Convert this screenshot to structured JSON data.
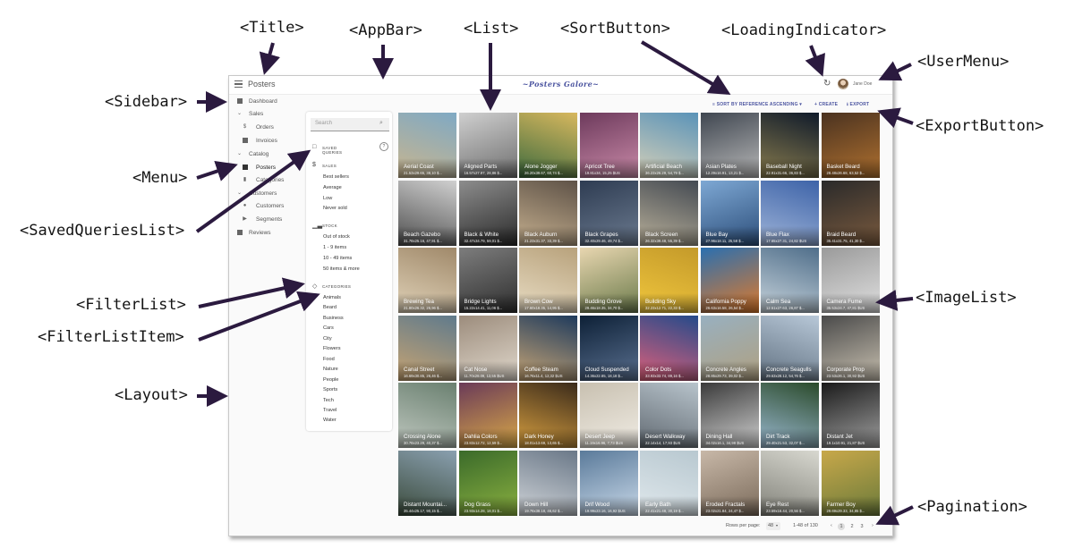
{
  "callouts": {
    "title": "<Title>",
    "appbar": "<AppBar>",
    "list": "<List>",
    "sort_button": "<SortButton>",
    "loading_indicator": "<LoadingIndicator>",
    "user_menu": "<UserMenu>",
    "sidebar": "<Sidebar>",
    "export_button": "<ExportButton>",
    "menu": "<Menu>",
    "saved_queries_list": "<SavedQueriesList>",
    "image_list": "<ImageList>",
    "filter_list": "<FilterList>",
    "filter_list_item": "<FilterListItem>",
    "layout": "<Layout>",
    "pagination": "<Pagination>"
  },
  "appbar": {
    "title": "Posters",
    "brand": "~Posters Galore~",
    "refresh_icon": "refresh-icon",
    "user_name": "Jane Doe"
  },
  "sidebar": {
    "items": [
      {
        "label": "Dashboard",
        "icon": "dashboard-icon"
      },
      {
        "label": "Sales",
        "icon": "chevron-down-icon"
      },
      {
        "label": "Orders",
        "icon": "dollar-icon"
      },
      {
        "label": "Invoices",
        "icon": "invoices-icon"
      },
      {
        "label": "Catalog",
        "icon": "chevron-down-icon"
      },
      {
        "label": "Posters",
        "icon": "posters-icon"
      },
      {
        "label": "Categories",
        "icon": "bookmark-icon"
      },
      {
        "label": "Customers",
        "icon": "chevron-down-icon"
      },
      {
        "label": "Customers",
        "icon": "people-icon"
      },
      {
        "label": "Segments",
        "icon": "label-icon"
      },
      {
        "label": "Reviews",
        "icon": "comment-icon"
      }
    ]
  },
  "filters": {
    "search_placeholder": "Search",
    "saved_queries": "SAVED QUERIES",
    "sales": {
      "title": "SALES",
      "items": [
        "Best sellers",
        "Average",
        "Low",
        "Never sold"
      ]
    },
    "stock": {
      "title": "STOCK",
      "items": [
        "Out of stock",
        "1 - 9 items",
        "10 - 49 items",
        "50 items & more"
      ]
    },
    "categories": {
      "title": "CATEGORIES",
      "items": [
        "Animals",
        "Beard",
        "Business",
        "Cars",
        "City",
        "Flowers",
        "Food",
        "Nature",
        "People",
        "Sports",
        "Tech",
        "Travel",
        "Water"
      ]
    }
  },
  "toolbar": {
    "sort_label": "SORT BY REFERENCE ASCENDING",
    "create_label": "CREATE",
    "export_label": "EXPORT"
  },
  "posters": [
    {
      "title": "Aerial Coast",
      "sub": "21.53x29.65, 38,10 $..."
    },
    {
      "title": "Aligned Parts",
      "sub": "16.57x27.97, 28,86 $..."
    },
    {
      "title": "Alone Jogger",
      "sub": "26.20x39.67, 60,74 $..."
    },
    {
      "title": "Apricot Tree",
      "sub": "19.81x34, 15,25 $US"
    },
    {
      "title": "Artificial Beach",
      "sub": "36.23x26.29, 54,79 $..."
    },
    {
      "title": "Asian Plates",
      "sub": "12.29x16.91, 13,21 $..."
    },
    {
      "title": "Baseball Night",
      "sub": "22.91x31.66, 36,83 $..."
    },
    {
      "title": "Basket Beard",
      "sub": "28.48x26.68, 63,52 $..."
    },
    {
      "title": "Beach Gazebo",
      "sub": "31.78x25.16, 47,91 $..."
    },
    {
      "title": "Black & White",
      "sub": "32.47x34.79, 59,01 $..."
    },
    {
      "title": "Black Auburn",
      "sub": "21.23x31.37, 33,39 $..."
    },
    {
      "title": "Black Grapes",
      "sub": "32.40x29.46, 49,74 $..."
    },
    {
      "title": "Black Screen",
      "sub": "26.32x39.48, 55,39 $..."
    },
    {
      "title": "Blue Bay",
      "sub": "27.96x18.11, 25,58 $..."
    },
    {
      "title": "Blue Flax",
      "sub": "17.65x27.31, 24,82 $US"
    },
    {
      "title": "Braid Beard",
      "sub": "35.41x31.75, 41,30 $..."
    },
    {
      "title": "Brewing Tea",
      "sub": "21.80x26.32, 26,96 $..."
    },
    {
      "title": "Bridge Lights",
      "sub": "15.22x14.41, 11,06 $..."
    },
    {
      "title": "Brown Cow",
      "sub": "17.60x18.35, 14,95 $..."
    },
    {
      "title": "Budding Grove",
      "sub": "29.46x18.35, 34,70 $..."
    },
    {
      "title": "Building Sky",
      "sub": "32.23x12.71, 22,33 $..."
    },
    {
      "title": "California Poppy",
      "sub": "26.63x16.58, 26,54 $..."
    },
    {
      "title": "Calm Sea",
      "sub": "12.51x27.63, 26,87 $..."
    },
    {
      "title": "Camera Fume",
      "sub": "35.53x24.7, 47,81 $US"
    },
    {
      "title": "Canal Street",
      "sub": "16.69x30.85, 26,46 $..."
    },
    {
      "title": "Cat Nose",
      "sub": "11.70x28.09, 13,55 $US"
    },
    {
      "title": "Coffee Steam",
      "sub": "16.76x11.4, 12,32 $US"
    },
    {
      "title": "Cloud Suspended",
      "sub": "14.36x22.85, 18,18 $..."
    },
    {
      "title": "Color Dots",
      "sub": "33.93x33.74, 89,16 $..."
    },
    {
      "title": "Concrete Angles",
      "sub": "28.85x29.73, 39,02 $..."
    },
    {
      "title": "Concrete Seagulls",
      "sub": "29.63x28.12, 54,76 $..."
    },
    {
      "title": "Corporate Prop",
      "sub": "23.53x26.1, 30,92 $US"
    },
    {
      "title": "Crossing Alone",
      "sub": "30.78x23.29, 40,37 $..."
    },
    {
      "title": "Dahlia Colors",
      "sub": "23.83x12.72, 12,59 $..."
    },
    {
      "title": "Dark Honey",
      "sub": "18.01x13.69, 13,65 $..."
    },
    {
      "title": "Desert Jeep",
      "sub": "11.19x16.96, 7,73 $US"
    },
    {
      "title": "Desert Walkway",
      "sub": "22.14x14, 17,93 $US"
    },
    {
      "title": "Dining Hall",
      "sub": "34.02x16.1, 34,98 $US"
    },
    {
      "title": "Dirt Track",
      "sub": "29.40x21.53, 32,07 $..."
    },
    {
      "title": "Distant Jet",
      "sub": "19.1x10.91, 21,87 $US"
    },
    {
      "title": "Distant Mountai...",
      "sub": "35.44x25.17, 90,15 $..."
    },
    {
      "title": "Dog Grass",
      "sub": "23.93x14.28, 18,01 $..."
    },
    {
      "title": "Down Hill",
      "sub": "19.76x38.18, 46,62 $..."
    },
    {
      "title": "Drif Wood",
      "sub": "19.99x23.16, 16,92 $US"
    },
    {
      "title": "Early Bath",
      "sub": "22.41x21.48, 30,19 $..."
    },
    {
      "title": "Eroded Fractals",
      "sub": "23.02x21.84, 24,47 $..."
    },
    {
      "title": "Eye Rest",
      "sub": "23.59x16.44, 20,56 $..."
    },
    {
      "title": "Farmer Boy",
      "sub": "29.69x29.33, 34,85 $..."
    }
  ],
  "pagination": {
    "rows_label": "Rows per page:",
    "rows_value": "48",
    "range": "1-48 of 130",
    "pages": [
      "1",
      "2",
      "3"
    ]
  }
}
